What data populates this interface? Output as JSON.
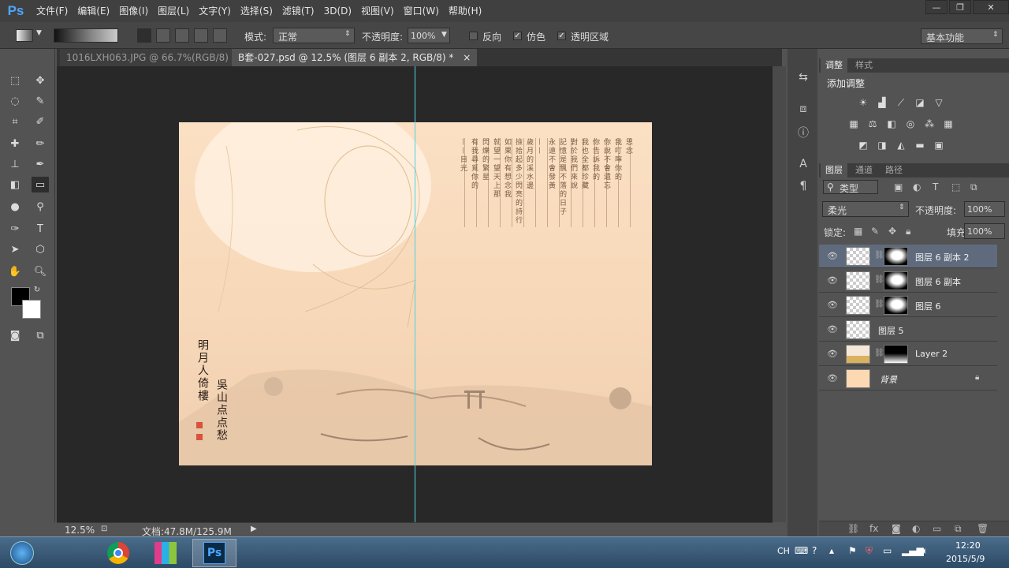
{
  "menu": {
    "logo": "Ps",
    "items": [
      "文件(F)",
      "编辑(E)",
      "图像(I)",
      "图层(L)",
      "文字(Y)",
      "选择(S)",
      "滤镜(T)",
      "3D(D)",
      "视图(V)",
      "窗口(W)",
      "帮助(H)"
    ]
  },
  "window_controls": {
    "minimize": "—",
    "restore": "❐",
    "close": "✕"
  },
  "options": {
    "mode_label": "模式:",
    "mode_value": "正常",
    "opacity_label": "不透明度:",
    "opacity_value": "100%",
    "reverse_label": "反向",
    "dither_label": "仿色",
    "transparency_label": "透明区域",
    "workspace": "基本功能",
    "reverse_checked": false,
    "dither_checked": true,
    "transparency_checked": true
  },
  "tabs": [
    {
      "label": "1016LXH063.JPG @ 66.7%(RGB/8)",
      "close": "×"
    },
    {
      "label": "B套-027.psd @ 12.5% (图层 6 副本 2, RGB/8) *",
      "close": "×"
    }
  ],
  "document": {
    "columns": [
      "思念",
      "我叮嚀你的",
      "你說不會遺忘",
      "你告訴我的",
      "我也全都珍藏",
      "對於我們來說",
      "記憶是飄不落的日子",
      "永遠不會發黃",
      "——",
      "歲月的溪水邊",
      "撿拾起多少閃亮的詩行",
      "如果你有想念我",
      "就望一望天上那",
      "閃爍的繁星",
      "有我尋覓你的",
      "——目光"
    ],
    "signature_left": "明月人倚樓",
    "signature_right": "吳山点点愁"
  },
  "status": {
    "zoom": "12.5%",
    "doc_info": "文档:47.8M/125.9M"
  },
  "adjust_panel": {
    "tabs": [
      "调整",
      "样式"
    ],
    "title": "添加调整"
  },
  "layers_panel": {
    "tabs": [
      "图层",
      "通道",
      "路径"
    ],
    "filter_label": "类型",
    "blend_mode": "柔光",
    "opacity_label": "不透明度:",
    "opacity_value": "100%",
    "lock_label": "锁定:",
    "fill_label": "填充:",
    "fill_value": "100%",
    "layers": [
      {
        "name": "图层 6 副本 2",
        "selected": true
      },
      {
        "name": "图层 6 副本",
        "selected": false
      },
      {
        "name": "图层 6",
        "selected": false
      },
      {
        "name": "图层 5",
        "selected": false
      },
      {
        "name": "Layer 2",
        "selected": false
      },
      {
        "name": "背景",
        "selected": false
      }
    ]
  },
  "taskbar": {
    "lang": "CH",
    "time": "12:20",
    "date": "2015/5/9"
  },
  "colors": {
    "accent": "#4da6ff",
    "guide": "#4fd3e0",
    "paper": "#f7d8b8",
    "selected_layer": "#5f6b7c"
  }
}
